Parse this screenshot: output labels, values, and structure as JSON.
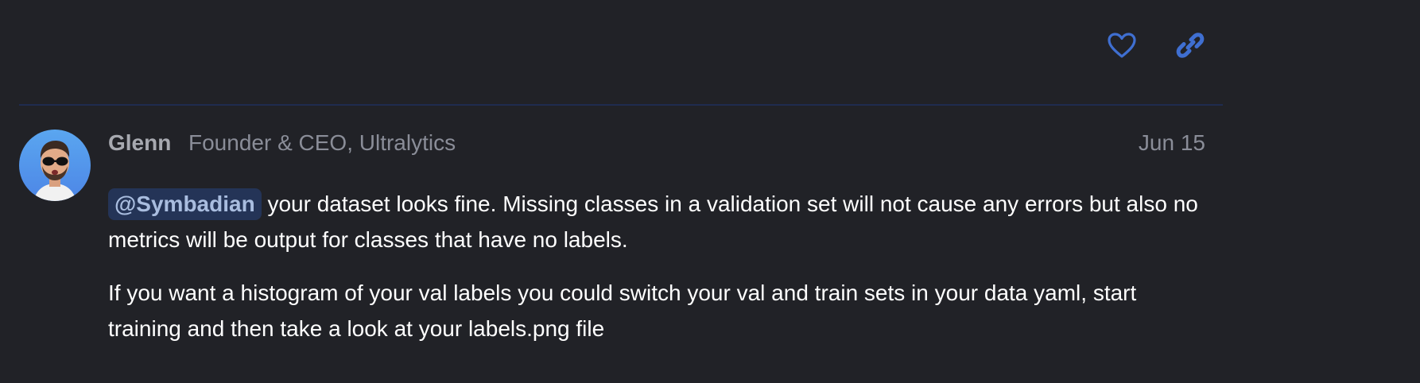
{
  "post": {
    "username": "Glenn",
    "user_title": "Founder & CEO, Ultralytics",
    "date": "Jun 15",
    "mention": "@Symbadian",
    "paragraph1_rest": " your dataset looks fine. Missing classes in a validation set will not cause any errors but also no metrics will be output for classes that have no labels.",
    "paragraph2": "If you want a histogram of your val labels you could switch your val and train sets in your data yaml, start training and then take a look at your labels.png file"
  },
  "actions": {
    "like_icon": "heart-icon",
    "link_icon": "link-icon"
  },
  "colors": {
    "background": "#212227",
    "accent": "#3f6fd1",
    "divider": "#1f2c4f",
    "mention_bg": "#243457",
    "mention_text": "#a9bddf"
  }
}
